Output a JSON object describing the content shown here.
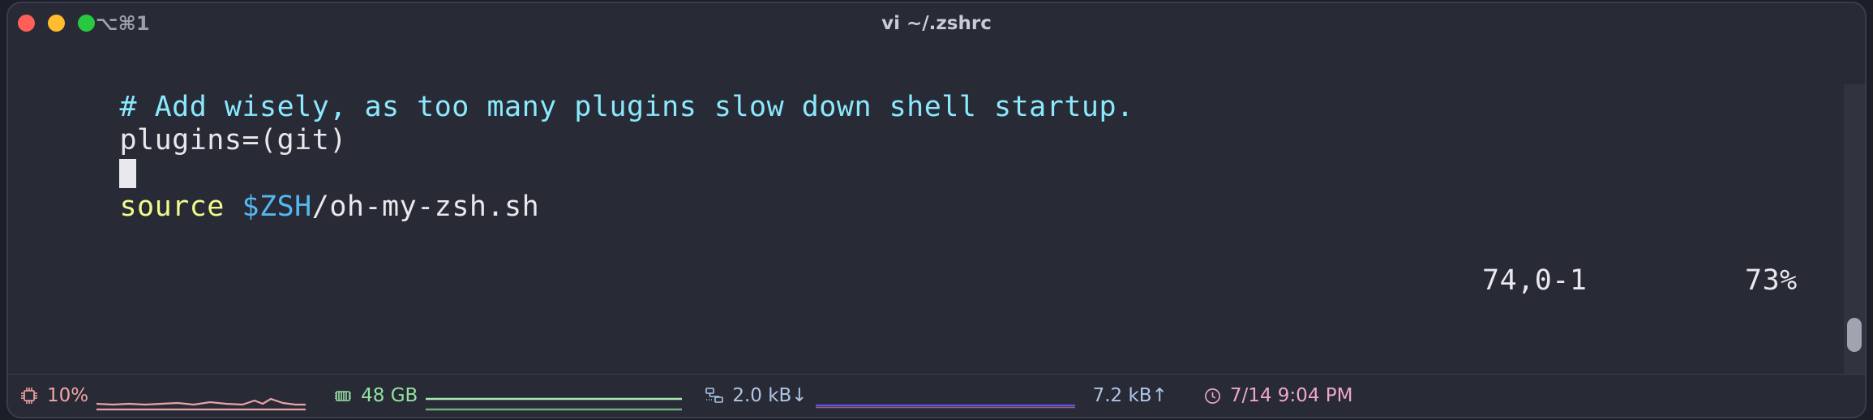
{
  "window": {
    "title": "vi ~/.zshrc",
    "tab_shortcut": "⌥⌘1",
    "background_color": "#282a36",
    "border_color": "#3a3d4d",
    "traffic_lights": [
      {
        "name": "close",
        "color": "#ff5f57"
      },
      {
        "name": "minimize",
        "color": "#febc2e"
      },
      {
        "name": "maximize",
        "color": "#28c840"
      }
    ]
  },
  "editor": {
    "lines": [
      {
        "id": "comment",
        "segments": [
          {
            "text": "# Add wisely, as too many plugins slow down shell startup.",
            "color": "#8be9fd",
            "role": "comment"
          }
        ]
      },
      {
        "id": "plugins",
        "segments": [
          {
            "text": "plugins=(git)",
            "color": "#e8e8ed",
            "role": "plain"
          }
        ]
      },
      {
        "id": "cursor-line",
        "segments": [
          {
            "text": "",
            "color": "#e8e8ed",
            "role": "cursor"
          }
        ]
      },
      {
        "id": "source",
        "segments": [
          {
            "text": "source ",
            "color": "#f1fa8c",
            "role": "keyword"
          },
          {
            "text": "$ZSH",
            "color": "#55b8f0",
            "role": "variable"
          },
          {
            "text": "/oh-my-zsh.sh",
            "color": "#e8e8ed",
            "role": "plain"
          }
        ]
      }
    ],
    "comment_text": "# Add wisely, as too many plugins slow down shell startup.",
    "plugins_text": "plugins=(git)",
    "source_keyword": "source ",
    "source_variable": "$ZSH",
    "source_path": "/oh-my-zsh.sh"
  },
  "vim_status": {
    "position": "74,0-1",
    "percent": "73%"
  },
  "statusbar": {
    "cpu": {
      "icon": "cpu-chip-icon",
      "value": "10%",
      "color": "#f3a6a6",
      "sparkline": [
        6,
        7,
        6,
        8,
        7,
        6,
        7,
        9,
        7,
        6,
        7,
        8,
        12,
        9,
        14,
        11,
        8,
        7,
        7,
        6,
        7,
        8,
        7,
        6,
        7,
        6
      ]
    },
    "memory": {
      "icon": "memory-stick-icon",
      "value": "48 GB",
      "color": "#93e0a0",
      "sparkline": [
        48,
        48,
        48,
        48,
        48,
        48,
        48,
        48,
        48,
        48,
        48,
        48,
        48,
        48,
        48,
        48,
        48,
        48,
        48,
        48
      ]
    },
    "network_down": {
      "icon": "network-icon",
      "value": "2.0 kB↓",
      "color": "#aec6e8",
      "sparkline": [
        2,
        2,
        2,
        2,
        2,
        2,
        2,
        2,
        2,
        2,
        2,
        2,
        2,
        2,
        2,
        2,
        2,
        2,
        2,
        2
      ]
    },
    "network_up": {
      "value": "7.2 kB↑",
      "color": "#aec6e8"
    },
    "clock": {
      "icon": "clock-icon",
      "value": "7/14 9:04 PM",
      "color": "#f0a6c8"
    }
  }
}
